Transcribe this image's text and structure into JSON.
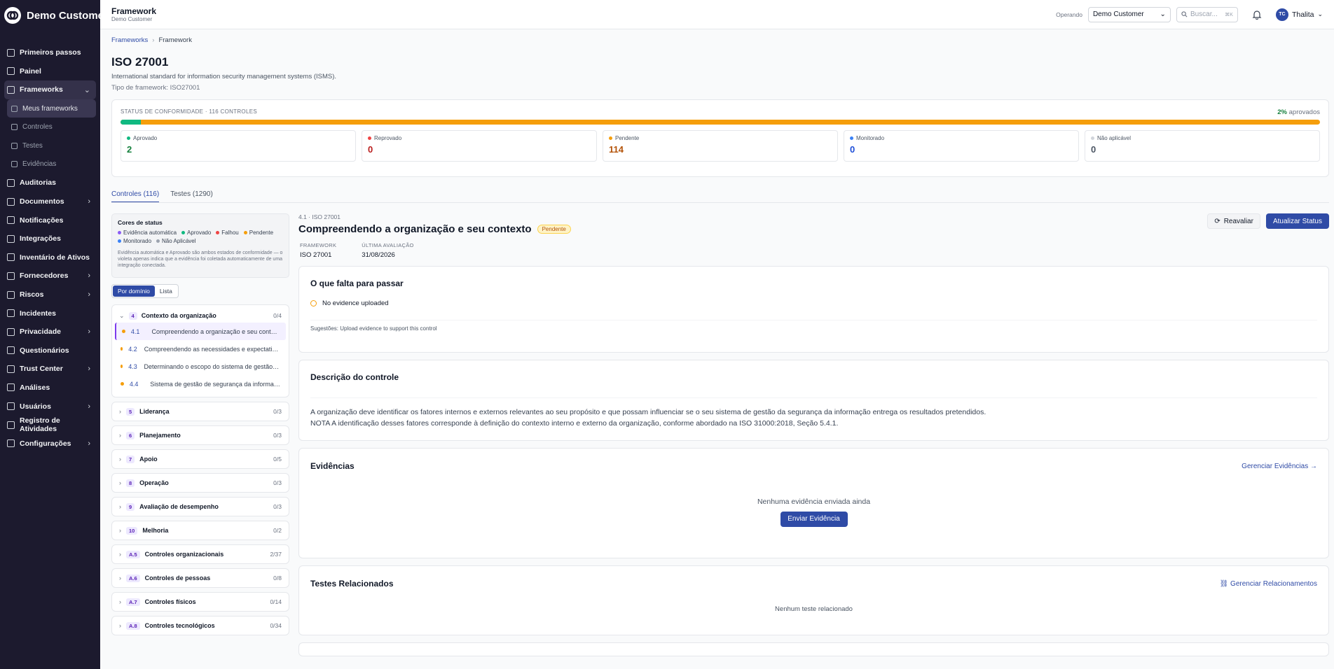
{
  "sidebar": {
    "brand": "Demo Customer",
    "items": [
      {
        "label": "Primeiros passos",
        "icon": "rocket-icon"
      },
      {
        "label": "Painel",
        "icon": "grid-icon"
      },
      {
        "label": "Frameworks",
        "icon": "file-icon"
      },
      {
        "label": "Meus frameworks",
        "icon": "file-icon"
      },
      {
        "label": "Controles",
        "icon": "sliders-icon"
      },
      {
        "label": "Testes",
        "icon": "pencil-icon"
      },
      {
        "label": "Evidências",
        "icon": "shield-icon"
      },
      {
        "label": "Auditorias",
        "icon": "clipboard-icon"
      },
      {
        "label": "Documentos",
        "icon": "document-icon"
      },
      {
        "label": "Notificações",
        "icon": "bell-icon"
      },
      {
        "label": "Integrações",
        "icon": "plug-icon"
      },
      {
        "label": "Inventário de Ativos",
        "icon": "box-icon"
      },
      {
        "label": "Fornecedores",
        "icon": "building-icon"
      },
      {
        "label": "Riscos",
        "icon": "warning-icon"
      },
      {
        "label": "Incidentes",
        "icon": "alert-icon"
      },
      {
        "label": "Privacidade",
        "icon": "shield-icon"
      },
      {
        "label": "Questionários",
        "icon": "list-icon"
      },
      {
        "label": "Trust Center",
        "icon": "globe-icon"
      },
      {
        "label": "Análises",
        "icon": "chart-icon"
      },
      {
        "label": "Usuários",
        "icon": "users-icon"
      },
      {
        "label": "Registro de Atividades",
        "icon": "history-icon"
      },
      {
        "label": "Configurações",
        "icon": "gear-icon"
      }
    ]
  },
  "topbar": {
    "title": "Framework",
    "subtitle": "Demo Customer",
    "operating_label": "Operando",
    "operating_value": "Demo Customer",
    "search_placeholder": "Buscar...",
    "search_shortcut": "⌘K",
    "user_initials": "TC",
    "user_name": "Thalita"
  },
  "breadcrumb": {
    "link": "Frameworks",
    "current": "Framework"
  },
  "framework": {
    "name": "ISO 27001",
    "description": "International standard for information security management systems (ISMS).",
    "type": "Tipo de framework: ISO27001"
  },
  "status": {
    "heading": "STATUS DE CONFORMIDADE · 116 CONTROLES",
    "approved_pct": "2%",
    "approved_pct_label": "aprovados",
    "progress_fraction": 0.017,
    "stats": [
      {
        "label": "Aprovado",
        "value": "2",
        "color": "#10b981",
        "text_color": "#15803d"
      },
      {
        "label": "Reprovado",
        "value": "0",
        "color": "#ef4444",
        "text_color": "#b91c1c"
      },
      {
        "label": "Pendente",
        "value": "114",
        "color": "#f59e0b",
        "text_color": "#b45309"
      },
      {
        "label": "Monitorado",
        "value": "0",
        "color": "#3b82f6",
        "text_color": "#1d4ed8"
      },
      {
        "label": "Não aplicável",
        "value": "0",
        "color": "#d1d5db",
        "text_color": "#4b5563"
      }
    ]
  },
  "tabs": [
    {
      "label": "Controles (116)",
      "active": true
    },
    {
      "label": "Testes (1290)",
      "active": false
    }
  ],
  "legend": {
    "title": "Cores de status",
    "items": [
      {
        "label": "Evidência automática",
        "color": "#8b5cf6"
      },
      {
        "label": "Aprovado",
        "color": "#10b981"
      },
      {
        "label": "Falhou",
        "color": "#ef4444"
      },
      {
        "label": "Pendente",
        "color": "#f59e0b"
      },
      {
        "label": "Monitorado",
        "color": "#3b82f6"
      },
      {
        "label": "Não Aplicável",
        "color": "#9ca3af"
      }
    ],
    "note": "Evidência automática e Aprovado são ambos estados de conformidade — o violeta apenas indica que a evidência foi coletada automaticamente de uma integração conectada."
  },
  "view_toggle": {
    "by_domain": "Por domínio",
    "list": "Lista"
  },
  "open_domain": {
    "num": "4",
    "name": "Contexto da organização",
    "count": "0/4",
    "controls": [
      {
        "id": "4.1",
        "name": "Compreendendo a organização e seu contexto"
      },
      {
        "id": "4.2",
        "name": "Compreendendo as necessidades e expectativas das partes interessadas"
      },
      {
        "id": "4.3",
        "name": "Determinando o escopo do sistema de gestão da segurança da informação"
      },
      {
        "id": "4.4",
        "name": "Sistema de gestão de segurança da informação"
      }
    ]
  },
  "domains": [
    {
      "num": "5",
      "name": "Liderança",
      "count": "0/3"
    },
    {
      "num": "6",
      "name": "Planejamento",
      "count": "0/3"
    },
    {
      "num": "7",
      "name": "Apoio",
      "count": "0/5"
    },
    {
      "num": "8",
      "name": "Operação",
      "count": "0/3"
    },
    {
      "num": "9",
      "name": "Avaliação de desempenho",
      "count": "0/3"
    },
    {
      "num": "10",
      "name": "Melhoria",
      "count": "0/2"
    },
    {
      "num": "A.5",
      "name": "Controles organizacionais",
      "count": "2/37"
    },
    {
      "num": "A.6",
      "name": "Controles de pessoas",
      "count": "0/8"
    },
    {
      "num": "A.7",
      "name": "Controles físicos",
      "count": "0/14"
    },
    {
      "num": "A.8",
      "name": "Controles tecnológicos",
      "count": "0/34"
    }
  ],
  "control": {
    "meta": "4.1 · ISO 27001",
    "title": "Compreendendo a organização e seu contexto",
    "badge": "Pendente",
    "reevaluate": "Reavaliar",
    "update_status": "Atualizar Status",
    "framework_label": "FRAMEWORK",
    "framework_value": "ISO 27001",
    "last_eval_label": "ÚLTIMA AVALIAÇÃO",
    "last_eval_value": "31/08/2026"
  },
  "gaps": {
    "title": "O que falta para passar",
    "item": "No evidence uploaded",
    "hint": "Sugestões: Upload evidence to support this control"
  },
  "description": {
    "title": "Descrição do controle",
    "line1": "A organização deve identificar os fatores internos e externos relevantes ao seu propósito e que possam influenciar se o seu sistema de gestão da segurança da informação entrega os resultados pretendidos.",
    "line2": "NOTA A identificação desses fatores corresponde à definição do contexto interno e externo da organização, conforme abordado na ISO 31000:2018, Seção 5.4.1."
  },
  "evidence": {
    "title": "Evidências",
    "manage": "Gerenciar Evidências →",
    "empty": "Nenhuma evidência enviada ainda",
    "send": "Enviar Evidência"
  },
  "tests": {
    "title": "Testes Relacionados",
    "manage": "Gerenciar Relacionamentos",
    "empty": "Nenhum teste relacionado"
  }
}
